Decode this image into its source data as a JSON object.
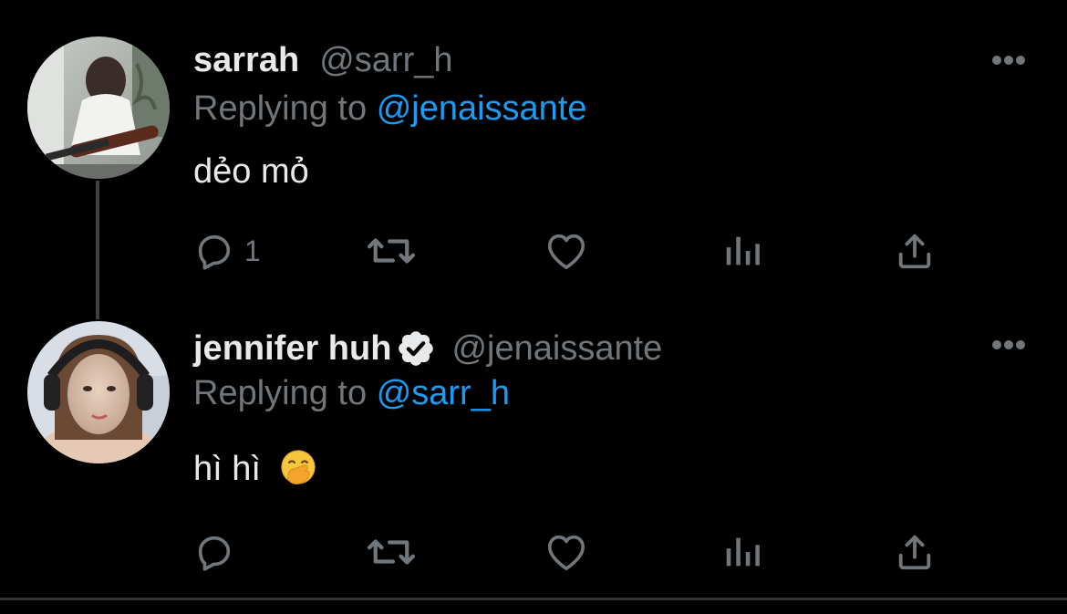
{
  "tweets": [
    {
      "display_name": "sarrah",
      "handle": "@sarr_h",
      "verified": false,
      "reply_prefix": "Replying to",
      "reply_target": "@jenaissante",
      "text": "dẻo mỏ",
      "emoji": "",
      "avatar_icon": "avatar-photo-guitar",
      "actions": {
        "reply_count": "1",
        "retweet_count": "",
        "like_count": "",
        "views_count": ""
      }
    },
    {
      "display_name": "jennifer huh",
      "handle": "@jenaissante",
      "verified": true,
      "reply_prefix": "Replying to",
      "reply_target": "@sarr_h",
      "text": "hì hì",
      "emoji": "hand-over-mouth-emoji",
      "avatar_icon": "avatar-photo-headphones",
      "actions": {
        "reply_count": "",
        "retweet_count": "",
        "like_count": "",
        "views_count": ""
      }
    }
  ],
  "colors": {
    "background": "#000000",
    "primary_text": "#e7e9ea",
    "secondary_text": "#71767b",
    "link": "#1d9bf0",
    "icon": "#71767b",
    "thread_line": "#3e4144"
  }
}
